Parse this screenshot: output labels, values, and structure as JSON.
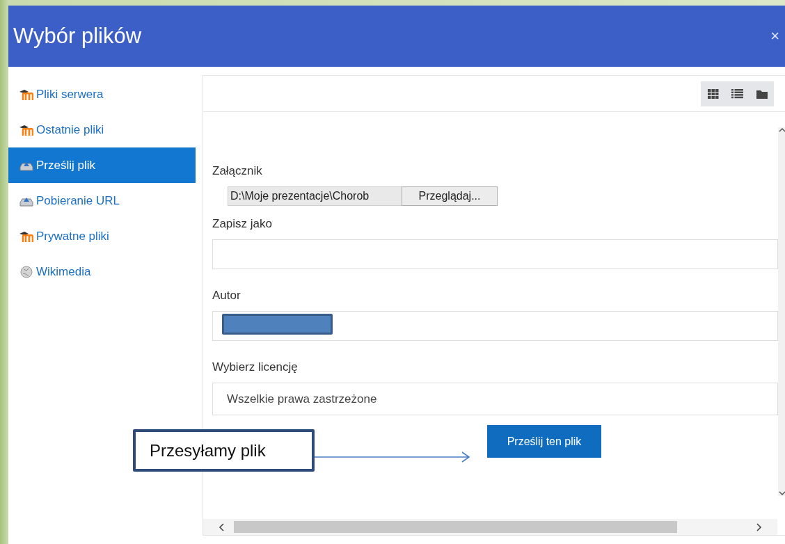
{
  "dialog": {
    "title": "Wybór plików",
    "close": "×"
  },
  "sidebar": {
    "items": [
      {
        "label": "Pliki serwera",
        "kind": "moodle",
        "selected": false
      },
      {
        "label": "Ostatnie pliki",
        "kind": "moodle",
        "selected": false
      },
      {
        "label": "Prześlij plik",
        "kind": "upload",
        "selected": true
      },
      {
        "label": "Pobieranie URL",
        "kind": "upload",
        "selected": false
      },
      {
        "label": "Prywatne pliki",
        "kind": "moodle",
        "selected": false
      },
      {
        "label": "Wikimedia",
        "kind": "globe",
        "selected": false
      }
    ]
  },
  "toolbar": {
    "views": [
      {
        "kind": "grid"
      },
      {
        "kind": "list"
      },
      {
        "kind": "folder"
      }
    ]
  },
  "form": {
    "fields": [
      {
        "kind": "file",
        "label": "Załącznik",
        "value": "D:\\Moje prezentacje\\Chorob",
        "button": "Przeglądaj..."
      },
      {
        "kind": "text",
        "label": "Zapisz jako"
      },
      {
        "kind": "text",
        "label": "Autor",
        "redacted": true
      },
      {
        "kind": "select",
        "label": "Wybierz licencję",
        "value": "Wszelkie prawa zastrzeżone"
      }
    ],
    "submit": "Prześlij ten plik"
  },
  "annotation": {
    "text": "Przesyłamy plik"
  }
}
